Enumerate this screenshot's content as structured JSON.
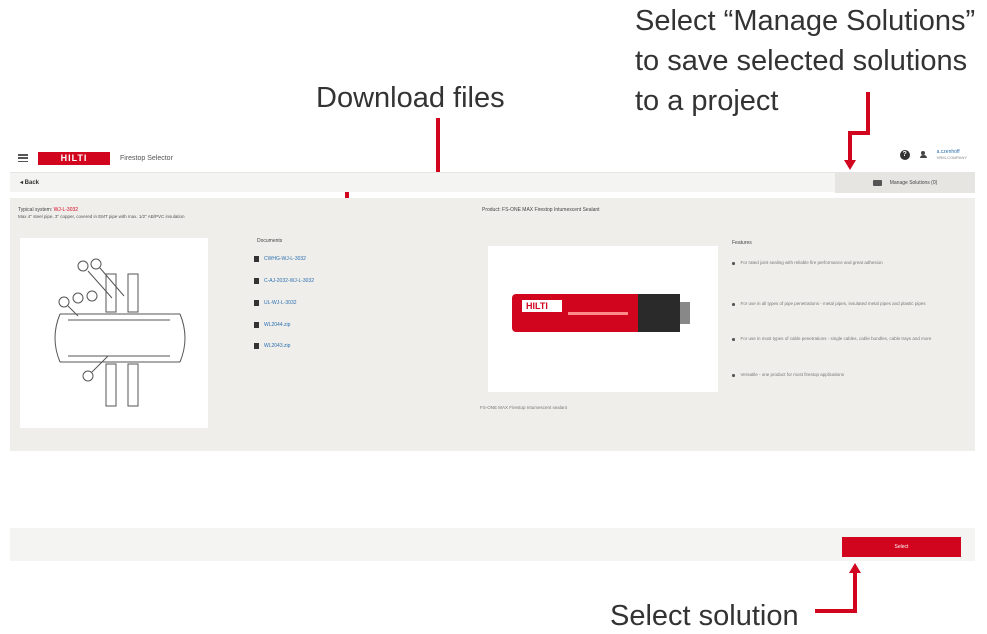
{
  "callouts": {
    "manage_solutions": [
      "Select “Manage Solutions”",
      "to save selected solutions",
      "to a project"
    ],
    "download_files": "Download files",
    "select_solution": "Select solution"
  },
  "header": {
    "logo_text": "HILTI",
    "app_title": "Firestop Selector",
    "help_icon": "?",
    "user_name": "a.czenhoff",
    "user_sub": "HRM-COMPANY"
  },
  "toolbar": {
    "back_label": "◂ Back",
    "manage_label": "Manage Solutions (0)"
  },
  "solution": {
    "typical_label": "Typical system:",
    "typical_value": "WJ-L-3032",
    "description": "Max 4\" steel pipe, 3\" copper, covered in EMT pipe with max. 1/2\" AB/PVC insulation"
  },
  "documents": {
    "title": "Documents",
    "items": [
      "CWHG-WJ-L-3032",
      "C-AJ-2032-WJ-L-3032",
      "UL-WJ-L-3032",
      "WL2044.zip",
      "WL2043.zip"
    ]
  },
  "product": {
    "title": "Product:  FS-ONE MAX Firestop Intumescent Sealant",
    "caption": "FS-ONE MAX Firestop Intumescent sealant",
    "cartridge_label": "HILTI"
  },
  "features": {
    "title": "Features",
    "items": [
      "For rated joint sealing with reliable fire performance and great adhesion",
      "For use in all types of pipe penetrations - metal pipes, insulated metal pipes and plastic pipes",
      "For use in most types of cable penetrations - single cables, cable bundles, cable trays and more",
      "Versatile - one product for most firestop applications"
    ]
  },
  "footer": {
    "select_label": "Select"
  },
  "colors": {
    "accent": "#d2051e",
    "link": "#2a6fb0"
  }
}
